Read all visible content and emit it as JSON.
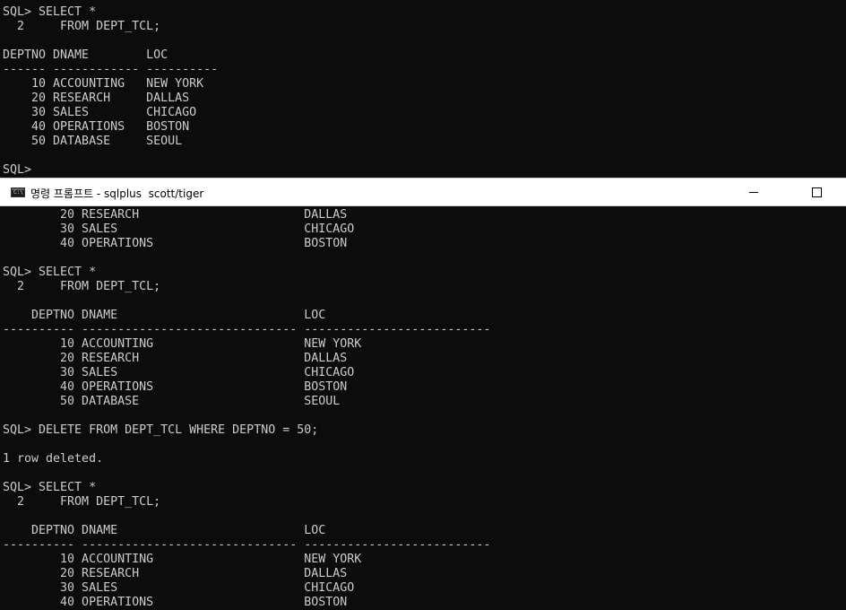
{
  "background_terminal": {
    "lines": [
      "SQL> SELECT *",
      "  2     FROM DEPT_TCL;",
      "",
      "DEPTNO DNAME        LOC",
      "------ ------------ ----------",
      "    10 ACCOUNTING   NEW YORK",
      "    20 RESEARCH     DALLAS",
      "    30 SALES        CHICAGO",
      "    40 OPERATIONS   BOSTON",
      "    50 DATABASE     SEOUL",
      "",
      "SQL>"
    ]
  },
  "window": {
    "title": "명령 프롬프트 - sqlplus  scott/tiger",
    "icon": "cmd-icon",
    "icon_text": "C:\\",
    "minimize_label": "minimize",
    "maximize_label": "maximize"
  },
  "main_terminal": {
    "lines": [
      "        20 RESEARCH                       DALLAS",
      "        30 SALES                          CHICAGO",
      "        40 OPERATIONS                     BOSTON",
      "",
      "SQL> SELECT *",
      "  2     FROM DEPT_TCL;",
      "",
      "    DEPTNO DNAME                          LOC",
      "---------- ------------------------------ --------------------------",
      "        10 ACCOUNTING                     NEW YORK",
      "        20 RESEARCH                       DALLAS",
      "        30 SALES                          CHICAGO",
      "        40 OPERATIONS                     BOSTON",
      "        50 DATABASE                       SEOUL",
      "",
      "SQL> DELETE FROM DEPT_TCL WHERE DEPTNO = 50;",
      "",
      "1 row deleted.",
      "",
      "SQL> SELECT *",
      "  2     FROM DEPT_TCL;",
      "",
      "    DEPTNO DNAME                          LOC",
      "---------- ------------------------------ --------------------------",
      "        10 ACCOUNTING                     NEW YORK",
      "        20 RESEARCH                       DALLAS",
      "        30 SALES                          CHICAGO",
      "        40 OPERATIONS                     BOSTON"
    ]
  },
  "colors": {
    "terminal_bg": "#0c0c0c",
    "terminal_fg": "#cccccc",
    "titlebar_bg": "#ffffff"
  }
}
